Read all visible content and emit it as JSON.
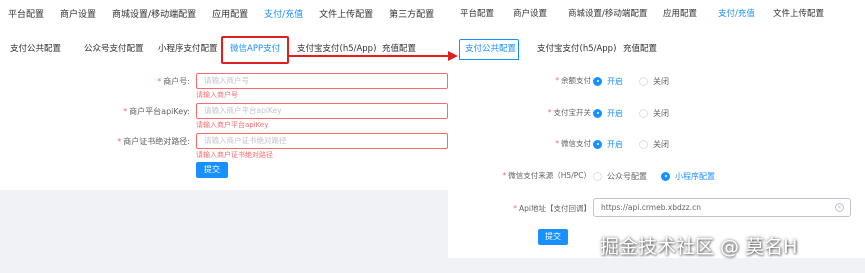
{
  "left": {
    "topnav": [
      "平台配置",
      "商户设置",
      "商城设置/移动端配置",
      "应用配置",
      "支付/充值",
      "文件上传配置",
      "第三方配置"
    ],
    "subtabs": [
      "支付公共配置",
      "公众号支付配置",
      "小程序支付配置",
      "微信APP支付",
      "支付宝支付(h5/App)",
      "充值配置"
    ],
    "form": [
      {
        "label": "商户号:",
        "placeholder": "请输入商户号",
        "error": "请输入商户号"
      },
      {
        "label": "商户平台apiKey:",
        "placeholder": "请输入商户平台apiKey",
        "error": "请输入商户平台apiKey"
      },
      {
        "label": "商户证书绝对路径:",
        "placeholder": "请输入商户证书绝对路径",
        "error": "请输入商户证书绝对路径"
      }
    ],
    "submit": "提交"
  },
  "right": {
    "topnav": [
      "平台配置",
      "商户设置",
      "商城设置/移动端配置",
      "应用配置",
      "支付/充值",
      "文件上传配置"
    ],
    "subtabs": [
      "支付公共配置",
      "支付宝支付(h5/App)",
      "充值配置"
    ],
    "rows": [
      {
        "label": "余额支付",
        "options": [
          "开启",
          "关闭"
        ]
      },
      {
        "label": "支付宝开关",
        "options": [
          "开启",
          "关闭"
        ]
      },
      {
        "label": "微信支付",
        "options": [
          "开启",
          "关闭"
        ]
      },
      {
        "label": "微信支付来源（H5/PC）",
        "options": [
          "公众号配置",
          "小程序配置"
        ]
      }
    ],
    "api": {
      "label": "Api地址【支付回调】",
      "value": "https://api.crmeb.xbdzz.cn"
    },
    "submit": "提交"
  },
  "watermark": "掘金技术社区 @ 莫名H",
  "colors": {
    "accent": "#1890ff",
    "error": "#f56c6c",
    "highlight": "#e02020"
  }
}
